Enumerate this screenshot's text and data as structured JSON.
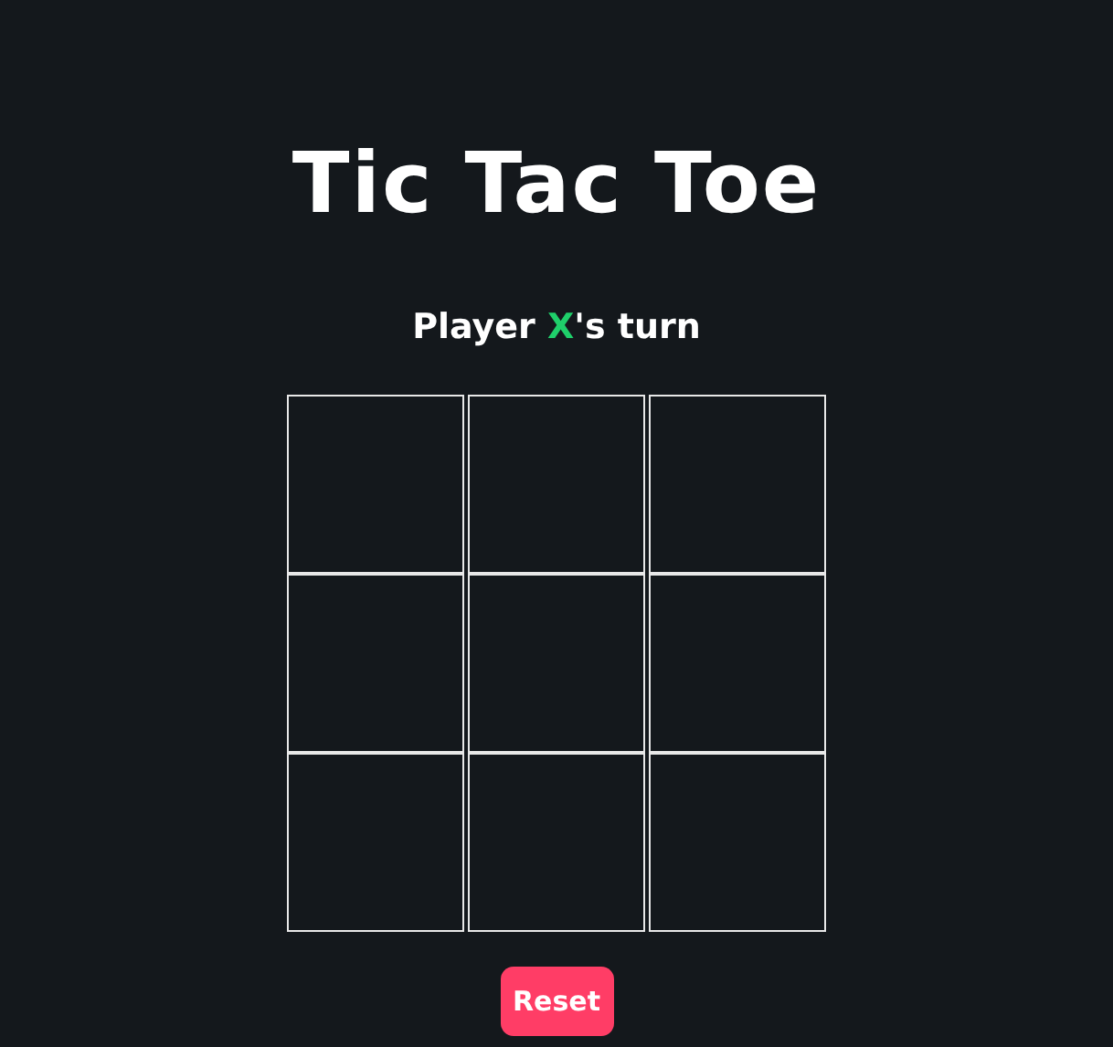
{
  "title": "Tic Tac Toe",
  "status": {
    "before": "Player ",
    "player": "X",
    "after": "'s turn"
  },
  "board": {
    "cells": [
      {},
      {},
      {},
      {},
      {},
      {},
      {},
      {},
      {}
    ]
  },
  "reset_button": "Reset"
}
